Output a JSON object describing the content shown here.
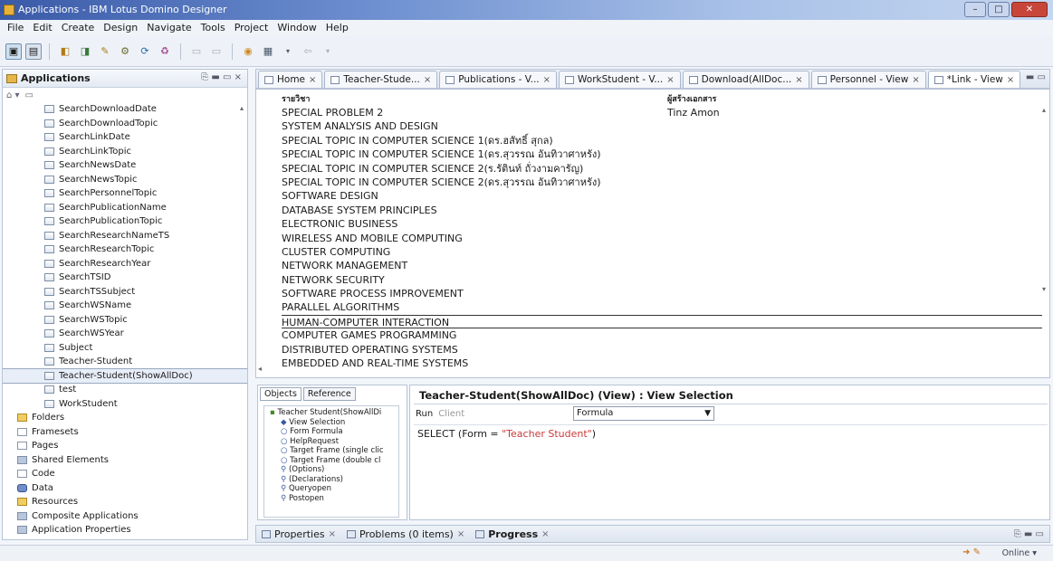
{
  "window": {
    "title": "Applications - IBM Lotus Domino Designer",
    "controls": [
      "–",
      "□",
      "✕"
    ]
  },
  "menu": [
    "File",
    "Edit",
    "Create",
    "Design",
    "Navigate",
    "Tools",
    "Project",
    "Window",
    "Help"
  ],
  "left_panel": {
    "title": "Applications",
    "items": [
      {
        "label": "SearchDownloadDate",
        "icon": "view-icon",
        "indent": 2
      },
      {
        "label": "SearchDownloadTopic",
        "icon": "view-icon",
        "indent": 2
      },
      {
        "label": "SearchLinkDate",
        "icon": "view-icon",
        "indent": 2
      },
      {
        "label": "SearchLinkTopic",
        "icon": "view-icon",
        "indent": 2
      },
      {
        "label": "SearchNewsDate",
        "icon": "view-icon",
        "indent": 2
      },
      {
        "label": "SearchNewsTopic",
        "icon": "view-icon",
        "indent": 2
      },
      {
        "label": "SearchPersonnelTopic",
        "icon": "view-icon",
        "indent": 2
      },
      {
        "label": "SearchPublicationName",
        "icon": "view-icon",
        "indent": 2
      },
      {
        "label": "SearchPublicationTopic",
        "icon": "view-icon",
        "indent": 2
      },
      {
        "label": "SearchResearchNameTS",
        "icon": "view-icon",
        "indent": 2
      },
      {
        "label": "SearchResearchTopic",
        "icon": "view-icon",
        "indent": 2
      },
      {
        "label": "SearchResearchYear",
        "icon": "view-icon",
        "indent": 2
      },
      {
        "label": "SearchTSID",
        "icon": "view-icon",
        "indent": 2
      },
      {
        "label": "SearchTSSubject",
        "icon": "view-icon",
        "indent": 2
      },
      {
        "label": "SearchWSName",
        "icon": "view-icon",
        "indent": 2
      },
      {
        "label": "SearchWSTopic",
        "icon": "view-icon",
        "indent": 2
      },
      {
        "label": "SearchWSYear",
        "icon": "view-icon",
        "indent": 2
      },
      {
        "label": "Subject",
        "icon": "view-icon",
        "indent": 2
      },
      {
        "label": "Teacher-Student",
        "icon": "view-icon",
        "indent": 2
      },
      {
        "label": "Teacher-Student(ShowAllDoc)",
        "icon": "view-icon",
        "indent": 2,
        "selected": true
      },
      {
        "label": "test",
        "icon": "view-icon",
        "indent": 2
      },
      {
        "label": "WorkStudent",
        "icon": "view-icon",
        "indent": 2
      },
      {
        "label": "Folders",
        "icon": "folder-icon",
        "indent": 1
      },
      {
        "label": "Framesets",
        "icon": "frameset-icon",
        "indent": 1
      },
      {
        "label": "Pages",
        "icon": "page-icon",
        "indent": 1
      },
      {
        "label": "Shared Elements",
        "icon": "shared-elements-icon",
        "indent": 1
      },
      {
        "label": "Code",
        "icon": "code-icon",
        "indent": 1
      },
      {
        "label": "Data",
        "icon": "data-icon",
        "indent": 1
      },
      {
        "label": "Resources",
        "icon": "resources-icon",
        "indent": 1
      },
      {
        "label": "Composite Applications",
        "icon": "composite-icon",
        "indent": 1
      },
      {
        "label": "Application Properties",
        "icon": "properties-icon",
        "indent": 1
      }
    ]
  },
  "tabs": [
    {
      "label": "Home",
      "close": "×"
    },
    {
      "label": "Teacher-Stude...",
      "close": "×"
    },
    {
      "label": "Publications - V...",
      "close": "×"
    },
    {
      "label": "WorkStudent - V...",
      "close": "×"
    },
    {
      "label": "Download(AllDoc...",
      "close": "×"
    },
    {
      "label": "Personnel - View",
      "close": "×"
    },
    {
      "label": "*Link - View",
      "close": "×"
    }
  ],
  "view": {
    "columns": [
      "รายวิชา",
      "ผู้สร้างเอกสาร"
    ],
    "rows": [
      {
        "subject": "SPECIAL PROBLEM 2",
        "author": "Tinz Amon"
      },
      {
        "subject": "SYSTEM ANALYSIS AND DESIGN",
        "author": ""
      },
      {
        "subject": "SPECIAL TOPIC IN COMPUTER SCIENCE 1(ดร.ฮสัทธิ์ สุกล)",
        "author": ""
      },
      {
        "subject": "SPECIAL TOPIC IN COMPUTER SCIENCE 1(ดร.สุวรรณ อันทิวาศาหรัง)",
        "author": ""
      },
      {
        "subject": "SPECIAL TOPIC IN COMPUTER SCIENCE 2(ร.รัตินท์ ถั่วงามคารัญ)",
        "author": ""
      },
      {
        "subject": "SPECIAL TOPIC IN COMPUTER SCIENCE 2(ดร.สุวรรณ อันทิวาศาหรัง)",
        "author": ""
      },
      {
        "subject": "SOFTWARE DESIGN",
        "author": ""
      },
      {
        "subject": "DATABASE SYSTEM PRINCIPLES",
        "author": ""
      },
      {
        "subject": "ELECTRONIC BUSINESS",
        "author": ""
      },
      {
        "subject": "WIRELESS AND MOBILE COMPUTING",
        "author": ""
      },
      {
        "subject": "CLUSTER COMPUTING",
        "author": ""
      },
      {
        "subject": "NETWORK MANAGEMENT",
        "author": ""
      },
      {
        "subject": "NETWORK SECURITY",
        "author": ""
      },
      {
        "subject": "SOFTWARE PROCESS IMPROVEMENT",
        "author": ""
      },
      {
        "subject": "PARALLEL ALGORITHMS",
        "author": ""
      },
      {
        "subject": "HUMAN-COMPUTER INTERACTION",
        "author": "",
        "highlighted": true
      },
      {
        "subject": "COMPUTER GAMES PROGRAMMING",
        "author": ""
      },
      {
        "subject": "DISTRIBUTED OPERATING SYSTEMS",
        "author": ""
      },
      {
        "subject": "EMBEDDED AND REAL-TIME SYSTEMS",
        "author": ""
      }
    ]
  },
  "objects_panel": {
    "tabs": [
      "Objects",
      "Reference"
    ],
    "items": [
      {
        "label": "Teacher Student(ShowAllDi",
        "indent": 0
      },
      {
        "label": "View Selection",
        "indent": 1
      },
      {
        "label": "Form Formula",
        "indent": 1
      },
      {
        "label": "HelpRequest",
        "indent": 1
      },
      {
        "label": "Target Frame (single clic",
        "indent": 1
      },
      {
        "label": "Target Frame (double cl",
        "indent": 1
      },
      {
        "label": "(Options)",
        "indent": 1
      },
      {
        "label": "(Declarations)",
        "indent": 1
      },
      {
        "label": "Queryopen",
        "indent": 1
      },
      {
        "label": "Postopen",
        "indent": 1
      }
    ]
  },
  "editor": {
    "title": "Teacher-Student(ShowAllDoc) (View) : View Selection",
    "run_label": "Run",
    "run_value": "Client",
    "formula_type": "Formula",
    "code_prefix": "SELECT (Form = ",
    "code_string": "\"Teacher Student\"",
    "code_suffix": ")"
  },
  "bottom_tabs": [
    {
      "label": "Properties",
      "close": "×"
    },
    {
      "label": "Problems (0 items)",
      "close": "×"
    },
    {
      "label": "Progress",
      "close": "×"
    }
  ],
  "status": {
    "online": "Online ▾"
  }
}
